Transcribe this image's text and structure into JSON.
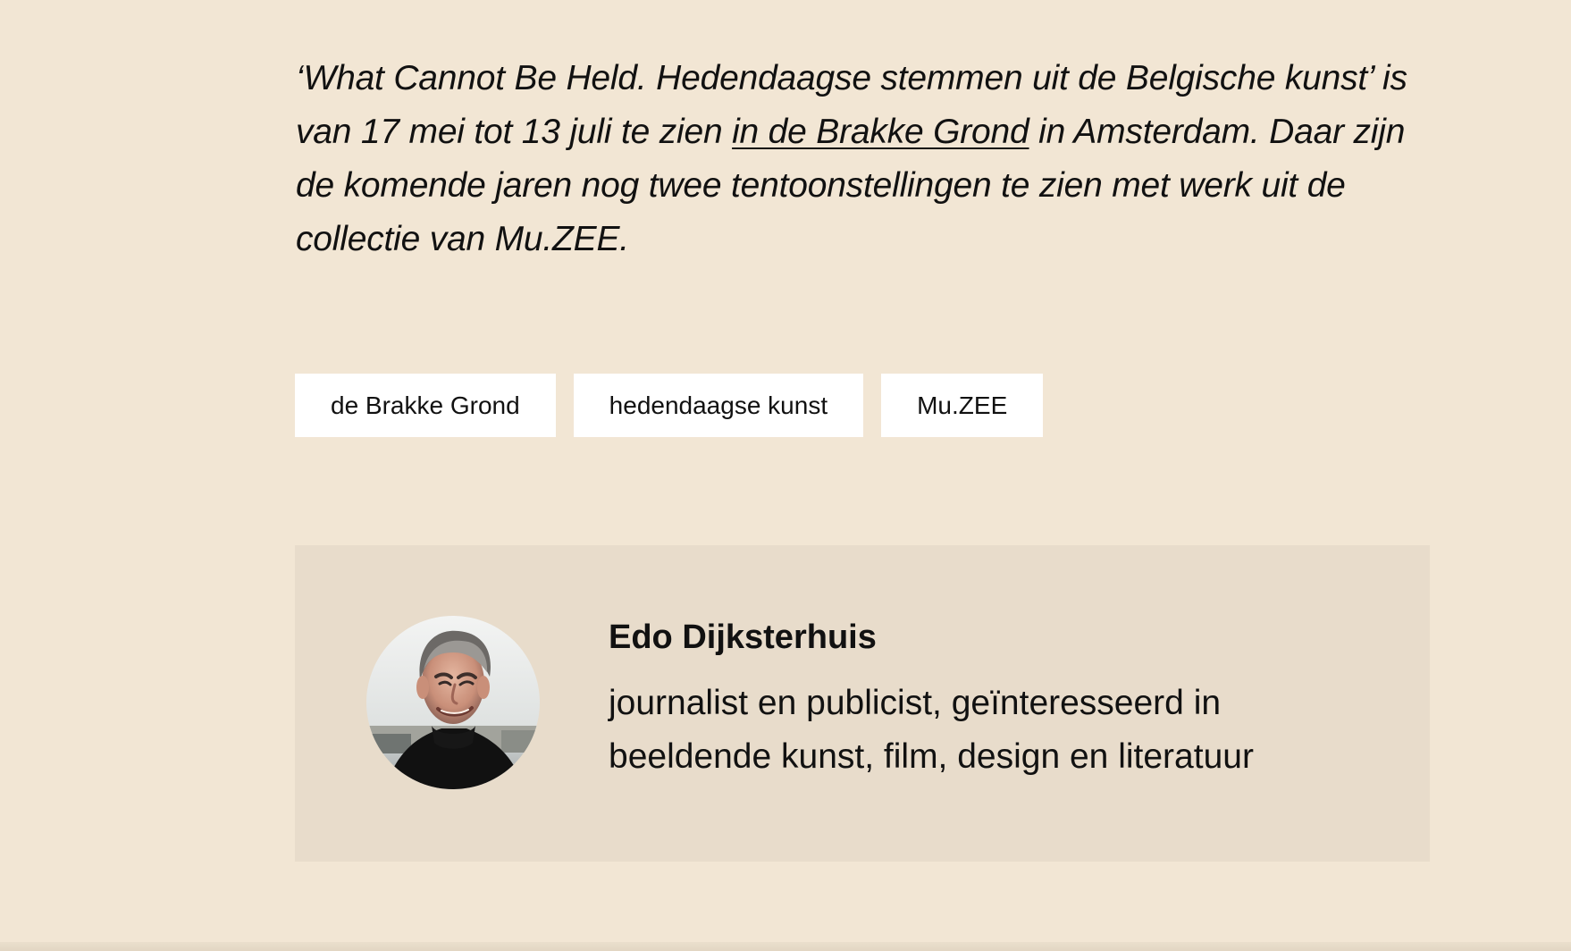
{
  "article": {
    "paragraph": {
      "before_link": "‘What Cannot Be Held. Hedendaagse stemmen uit de Belgische kunst’ is van 17 mei tot 13 juli te zien ",
      "link_text": "in de Brakke Grond",
      "after_link": " in Amsterdam. Daar zijn de komende jaren nog twee tentoonstellingen te zien met werk uit de collectie van Mu.ZEE."
    }
  },
  "tags": [
    {
      "label": "de Brakke Grond"
    },
    {
      "label": "hedendaagse kunst"
    },
    {
      "label": "Mu.ZEE"
    }
  ],
  "author": {
    "name": "Edo Dijksterhuis",
    "bio": "journalist en publicist, geïnteresseerd in beeldende kunst, film, design en literatuur"
  },
  "colors": {
    "page_background": "#f2e6d4",
    "author_box_background": "#e8dccb",
    "tag_background": "#ffffff",
    "text": "#111111"
  }
}
